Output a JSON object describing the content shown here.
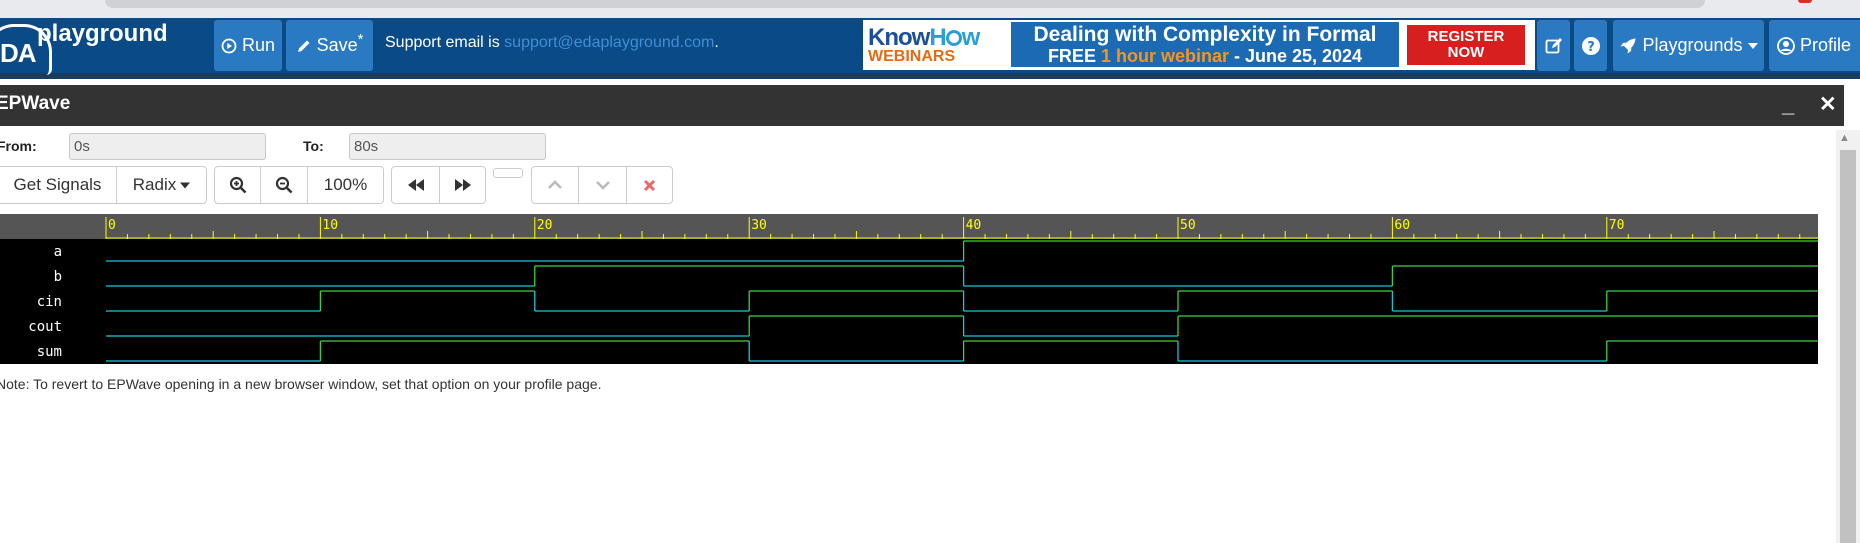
{
  "navbar": {
    "logo_abbr": "DA",
    "logo_text": "playground",
    "run_label": "Run",
    "save_label": "Save",
    "save_marker": "*",
    "support_prefix": "Support email is ",
    "support_email": "support@edaplayground.com",
    "support_suffix": ".",
    "playgrounds_label": "Playgrounds",
    "profile_label": "Profile",
    "color": "#0a4a86",
    "button_color": "#2a7ac3"
  },
  "ad": {
    "brand_a": "Know",
    "brand_b": "H",
    "brand_c": "w",
    "brand_sub": "WEBINARS",
    "line1": "Dealing with Complexity in Formal",
    "line2_a": "FREE ",
    "line2_b": "1 hour webinar",
    "line2_c": " - June 25, 2024",
    "cta_line1": "REGISTER",
    "cta_line2": "NOW"
  },
  "panel": {
    "title": "EPWave",
    "minimize": "_",
    "close": "✕"
  },
  "range": {
    "from_label": "From:",
    "from_value": "0s",
    "to_label": "To:",
    "to_value": "80s"
  },
  "toolbar": {
    "get_signals": "Get Signals",
    "radix": "Radix",
    "zoom_level": "100%"
  },
  "waveform": {
    "time_start": 0,
    "time_end": 80,
    "major_ticks": [
      0,
      10,
      20,
      30,
      40,
      50,
      60,
      70
    ],
    "ruler_color": "#555555",
    "tick_color": "#ffff00",
    "low_color": "#18c8d8",
    "high_color": "#3cd23c",
    "signals": [
      {
        "name": "a",
        "changes": [
          [
            0,
            0
          ],
          [
            40,
            1
          ]
        ]
      },
      {
        "name": "b",
        "changes": [
          [
            0,
            0
          ],
          [
            20,
            1
          ],
          [
            40,
            0
          ],
          [
            60,
            1
          ]
        ]
      },
      {
        "name": "cin",
        "changes": [
          [
            0,
            0
          ],
          [
            10,
            1
          ],
          [
            20,
            0
          ],
          [
            30,
            1
          ],
          [
            40,
            0
          ],
          [
            50,
            1
          ],
          [
            60,
            0
          ],
          [
            70,
            1
          ]
        ]
      },
      {
        "name": "cout",
        "changes": [
          [
            0,
            0
          ],
          [
            30,
            1
          ],
          [
            40,
            0
          ],
          [
            50,
            1
          ]
        ]
      },
      {
        "name": "sum",
        "changes": [
          [
            0,
            0
          ],
          [
            10,
            1
          ],
          [
            30,
            0
          ],
          [
            40,
            1
          ],
          [
            50,
            0
          ],
          [
            70,
            1
          ]
        ]
      }
    ]
  },
  "note": "Note: To revert to EPWave opening in a new browser window, set that option on your profile page."
}
